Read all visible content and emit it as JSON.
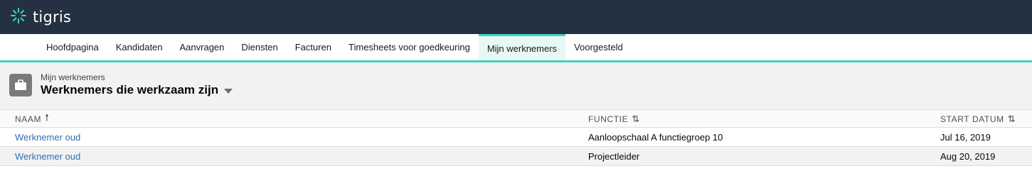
{
  "app": {
    "logo_text": "tigris",
    "logo_icon": "tigris-burst-icon",
    "colors": {
      "topbar": "#243142",
      "accent": "#3ed3bd",
      "link": "#2f6fb3"
    }
  },
  "nav": {
    "items": [
      {
        "label": "Hoofdpagina"
      },
      {
        "label": "Kandidaten"
      },
      {
        "label": "Aanvragen"
      },
      {
        "label": "Diensten"
      },
      {
        "label": "Facturen"
      },
      {
        "label": "Timesheets voor goedkeuring"
      },
      {
        "label": "Mijn werknemers"
      },
      {
        "label": "Voorgesteld"
      }
    ],
    "active": "Mijn werknemers"
  },
  "header": {
    "icon": "briefcase-icon",
    "subtitle": "Mijn werknemers",
    "title": "Werknemers die werkzaam zijn"
  },
  "table": {
    "columns": [
      {
        "label": "NAAM",
        "sort_icon": "arrow-up-icon",
        "sort_glyph": "🠕"
      },
      {
        "label": "FUNCTIE",
        "sort_icon": "sort-icon",
        "sort_glyph": "⇅"
      },
      {
        "label": "START DATUM",
        "sort_icon": "sort-icon",
        "sort_glyph": "⇅"
      }
    ],
    "rows": [
      {
        "naam": "Werknemer oud",
        "functie": "Aanloopschaal A functiegroep 10",
        "start_datum": "Jul 16, 2019"
      },
      {
        "naam": "Werknemer oud",
        "functie": "Projectleider",
        "start_datum": "Aug 20, 2019"
      }
    ]
  }
}
